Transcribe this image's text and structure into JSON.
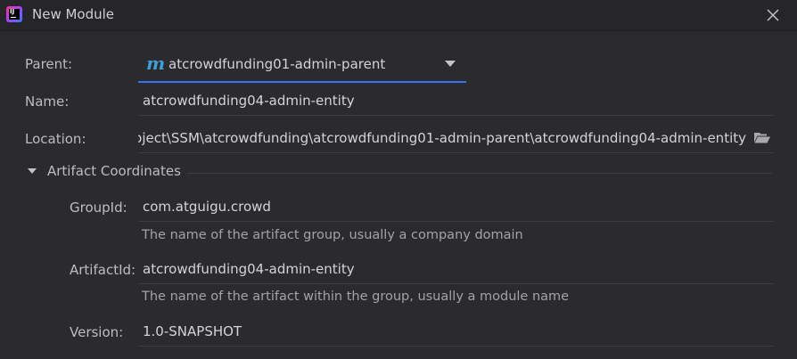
{
  "window": {
    "title": "New Module"
  },
  "form": {
    "parent_label": "Parent:",
    "parent_value": "atcrowdfunding01-admin-parent",
    "name_label": "Name:",
    "name_value": "atcrowdfunding04-admin-entity",
    "location_label": "Location:",
    "location_value": "oject\\SSM\\atcrowdfunding\\atcrowdfunding01-admin-parent\\atcrowdfunding04-admin-entity"
  },
  "artifact": {
    "section_title": "Artifact Coordinates",
    "groupid_label": "GroupId:",
    "groupid_value": "com.atguigu.crowd",
    "groupid_hint": "The name of the artifact group, usually a company domain",
    "artifactid_label": "ArtifactId:",
    "artifactid_value": "atcrowdfunding04-admin-entity",
    "artifactid_hint": "The name of the artifact within the group, usually a module name",
    "version_label": "Version:",
    "version_value": "1.0-SNAPSHOT"
  },
  "icons": {
    "app": "intellij-app-icon",
    "close": "close-icon",
    "maven": "maven-icon",
    "dropdown": "chevron-down-icon",
    "folder": "folder-icon",
    "collapse": "triangle-down-icon"
  },
  "colors": {
    "background": "#2b2b2e",
    "accent": "#3574f0",
    "maven": "#3e9fd6"
  }
}
